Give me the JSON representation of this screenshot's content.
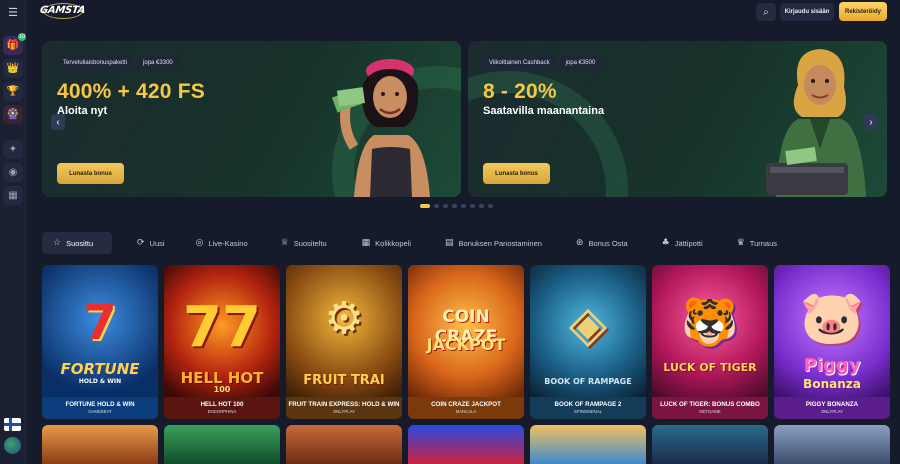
{
  "header": {
    "logo_text": "GAMSTA",
    "search_icon": "search-icon",
    "login_label": "Kirjaudu sisään",
    "register_label": "Rekisteröidy"
  },
  "sidebar": {
    "menu_icon": "menu-icon",
    "badge": "10",
    "items": [
      "gift-icon",
      "crown-icon",
      "trophy-icon",
      "wheel-icon",
      "ticket-icon",
      "chip-icon",
      "slot-machine-icon"
    ],
    "language": "fi"
  },
  "banners": [
    {
      "chips": [
        "Tervetuliaisbonuspaketti",
        "jopa €3300"
      ],
      "title": "400% + 420 FS",
      "subtitle": "Aloita nyt",
      "button": "Lunasta bonus"
    },
    {
      "chips": [
        "Viikoittainen Cashback",
        "jopa €3500"
      ],
      "title": "8 - 20%",
      "subtitle": "Saatavilla maanantaina",
      "button": "Lunasta bonus"
    }
  ],
  "carousel": {
    "active_index": 0,
    "count": 8
  },
  "colors": {
    "accent": "#f1c84b",
    "background": "#161b2b",
    "panel": "#252c42"
  },
  "tabs": [
    {
      "label": "Suosittu",
      "icon": "star-icon"
    },
    {
      "label": "Uusi",
      "icon": "new-icon"
    },
    {
      "label": "Live-Kasino",
      "icon": "live-icon"
    },
    {
      "label": "Suositeltu",
      "icon": "recommended-icon"
    },
    {
      "label": "Kolikkopeli",
      "icon": "slot-icon"
    },
    {
      "label": "Bonuksen Panostaminen",
      "icon": "bonus-wager-icon"
    },
    {
      "label": "Bonus Osta",
      "icon": "bonus-buy-icon"
    },
    {
      "label": "Jättipotti",
      "icon": "jackpot-icon"
    },
    {
      "label": "Turnaus",
      "icon": "tournament-icon"
    }
  ],
  "games": [
    {
      "name": "FORTUNE HOLD & WIN",
      "provider": "GAMEBEAT",
      "art": "FORTUNE",
      "art_sub": "HOLD & WIN"
    },
    {
      "name": "HELL HOT 100",
      "provider": "ENDORPHINA",
      "art": "HELL HOT",
      "art_sub": "100"
    },
    {
      "name": "FRUIT TRAIN EXPRESS: HOLD & WIN",
      "provider": "ONLYPLAY",
      "art": "FRUIT TRAI",
      "art_sub": ""
    },
    {
      "name": "COIN CRAZE JACKPOT",
      "provider": "MANCALA",
      "art": "COIN CRAZE",
      "art_sub": "JACKPOT"
    },
    {
      "name": "BOOK OF RAMPAGE 2",
      "provider": "SPINOMENAL",
      "art": "BOOK OF RAMPAGE",
      "art_sub": ""
    },
    {
      "name": "LUCK OF TIGER: BONUS COMBO",
      "provider": "NETGAME",
      "art": "LUCK OF TIGER",
      "art_sub": ""
    },
    {
      "name": "PIGGY BONANZA",
      "provider": "ONLYPLAY",
      "art": "Piggy",
      "art_sub": "Bonanza"
    }
  ]
}
